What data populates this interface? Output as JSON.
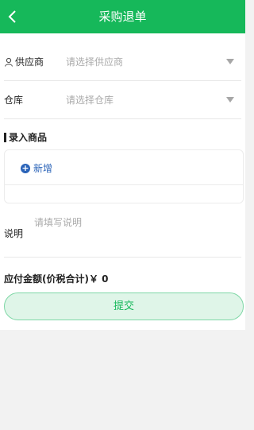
{
  "header": {
    "title": "采购退单",
    "back_icon": "chevron-left-icon"
  },
  "supplier": {
    "label": "供应商",
    "placeholder": "请选择供应商",
    "icon": "person-icon"
  },
  "warehouse": {
    "label": "仓库",
    "placeholder": "请选择仓库"
  },
  "goods": {
    "section_title": "录入商品",
    "add_label": "新增"
  },
  "note": {
    "label": "说明",
    "placeholder": "请填写说明"
  },
  "amount": {
    "text": "应付金额(价税合计)￥ 0"
  },
  "submit": {
    "label": "提交"
  },
  "colors": {
    "brand": "#16b85a",
    "link": "#2a63b8"
  }
}
